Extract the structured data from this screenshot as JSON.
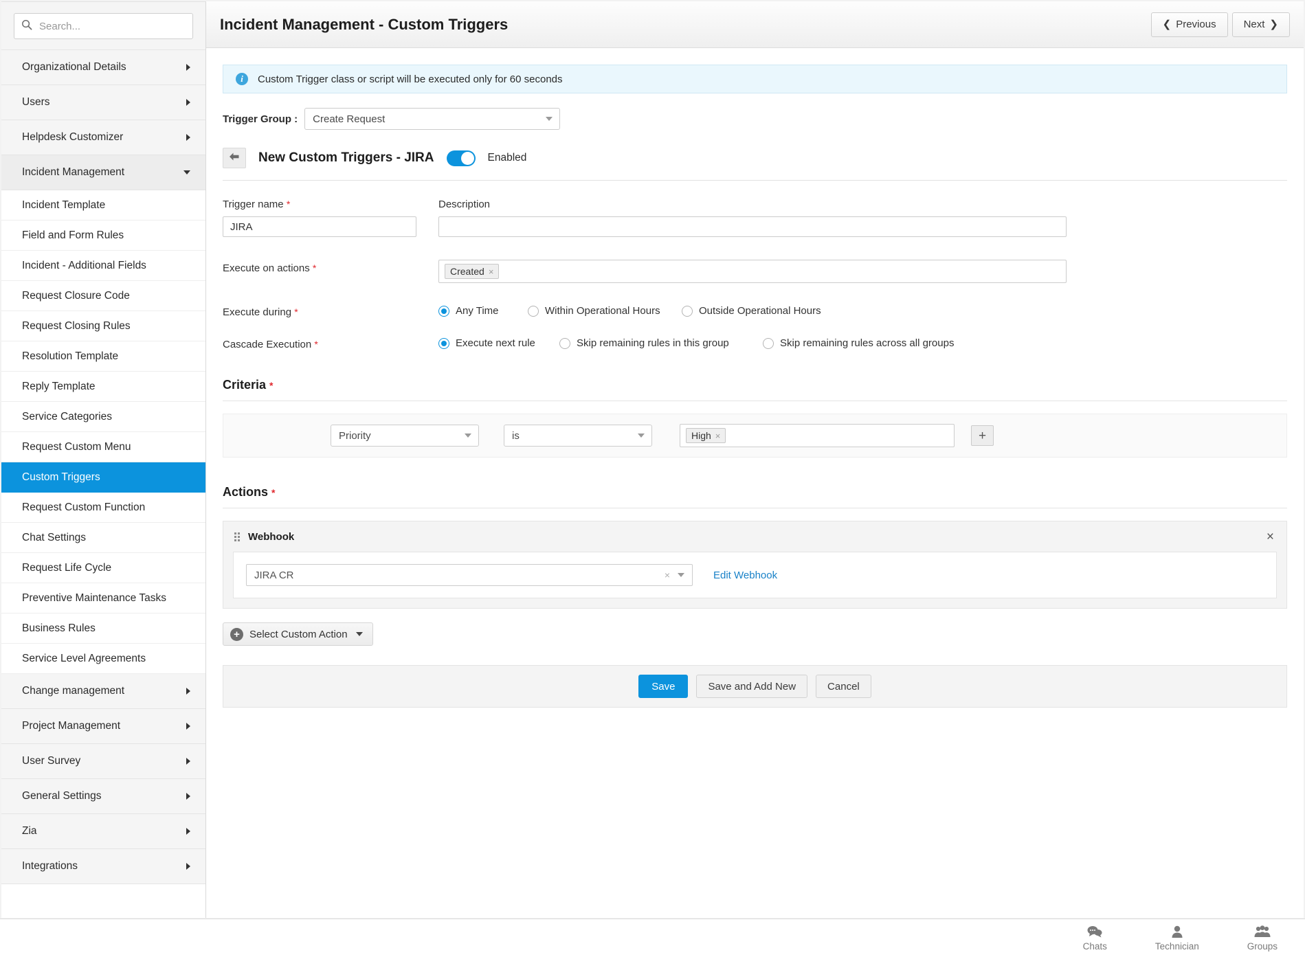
{
  "search": {
    "placeholder": "Search...",
    "value": "",
    "icon": "search-icon"
  },
  "sidebar": {
    "items": [
      {
        "label": "Organizational Details",
        "type": "group",
        "state": "collapsed"
      },
      {
        "label": "Users",
        "type": "group",
        "state": "collapsed"
      },
      {
        "label": "Helpdesk Customizer",
        "type": "group",
        "state": "collapsed"
      },
      {
        "label": "Incident Management",
        "type": "group",
        "state": "expanded"
      },
      {
        "label": "Incident Template",
        "type": "child"
      },
      {
        "label": "Field and Form Rules",
        "type": "child"
      },
      {
        "label": "Incident - Additional Fields",
        "type": "child"
      },
      {
        "label": "Request Closure Code",
        "type": "child"
      },
      {
        "label": "Request Closing Rules",
        "type": "child"
      },
      {
        "label": "Resolution Template",
        "type": "child"
      },
      {
        "label": "Reply Template",
        "type": "child"
      },
      {
        "label": "Service Categories",
        "type": "child"
      },
      {
        "label": "Request Custom Menu",
        "type": "child"
      },
      {
        "label": "Custom Triggers",
        "type": "child",
        "active": true
      },
      {
        "label": "Request Custom Function",
        "type": "child"
      },
      {
        "label": "Chat Settings",
        "type": "child"
      },
      {
        "label": "Request Life Cycle",
        "type": "child"
      },
      {
        "label": "Preventive Maintenance Tasks",
        "type": "child"
      },
      {
        "label": "Business Rules",
        "type": "child"
      },
      {
        "label": "Service Level Agreements",
        "type": "child"
      },
      {
        "label": "Change management",
        "type": "group",
        "state": "collapsed"
      },
      {
        "label": "Project Management",
        "type": "group",
        "state": "collapsed"
      },
      {
        "label": "User Survey",
        "type": "group",
        "state": "collapsed"
      },
      {
        "label": "General Settings",
        "type": "group",
        "state": "collapsed"
      },
      {
        "label": "Zia",
        "type": "group",
        "state": "collapsed"
      },
      {
        "label": "Integrations",
        "type": "group",
        "state": "collapsed"
      }
    ]
  },
  "header": {
    "title": "Incident Management - Custom Triggers",
    "previous_label": "Previous",
    "next_label": "Next"
  },
  "info_bar": {
    "icon": "info-icon",
    "message": "Custom Trigger class or script will be executed only for 60 seconds"
  },
  "trigger_group": {
    "label": "Trigger Group :",
    "value": "Create Request"
  },
  "subheader": {
    "back_icon": "back-arrow-icon",
    "title": "New Custom Triggers - JIRA",
    "toggle_state": "on",
    "toggle_label": "Enabled"
  },
  "form": {
    "trigger_name": {
      "label": "Trigger name",
      "required": "*",
      "value": "JIRA"
    },
    "description": {
      "label": "Description",
      "value": "",
      "placeholder": ""
    },
    "execute_on_actions": {
      "label": "Execute on actions",
      "required": "*",
      "chips": [
        {
          "label": "Created",
          "remove": "×"
        }
      ]
    },
    "execute_during": {
      "label": "Execute during",
      "required": "*",
      "options": [
        {
          "label": "Any Time",
          "selected": true
        },
        {
          "label": "Within Operational Hours",
          "selected": false
        },
        {
          "label": "Outside Operational Hours",
          "selected": false
        }
      ]
    },
    "cascade_execution": {
      "label": "Cascade Execution",
      "required": "*",
      "options": [
        {
          "label": "Execute next rule",
          "selected": true
        },
        {
          "label": "Skip remaining rules in this group",
          "selected": false
        },
        {
          "label": "Skip remaining rules across all groups",
          "selected": false
        }
      ]
    }
  },
  "criteria": {
    "title": "Criteria",
    "required": "*",
    "rows": [
      {
        "field": "Priority",
        "operator": "is",
        "values": [
          {
            "label": "High",
            "remove": "×"
          }
        ],
        "add_label": "+"
      }
    ]
  },
  "actions": {
    "title": "Actions",
    "required": "*",
    "cards": [
      {
        "drag_handle": "drag-handle-icon",
        "name": "Webhook",
        "close": "×",
        "select_value": "JIRA CR",
        "clear": "×",
        "link_label": "Edit Webhook"
      }
    ],
    "select_custom_action_label": "Select Custom Action"
  },
  "footer": {
    "save_label": "Save",
    "save_add_new_label": "Save and Add New",
    "cancel_label": "Cancel"
  },
  "statusbar": {
    "items": [
      {
        "label": "Chats",
        "icon": "chats-icon"
      },
      {
        "label": "Technician",
        "icon": "person-icon"
      },
      {
        "label": "Groups",
        "icon": "groups-icon"
      }
    ]
  },
  "colors": {
    "accent": "#0c93dd",
    "required": "#e0282e",
    "info_bg": "#eaf7fd",
    "link": "#1a82c8"
  }
}
